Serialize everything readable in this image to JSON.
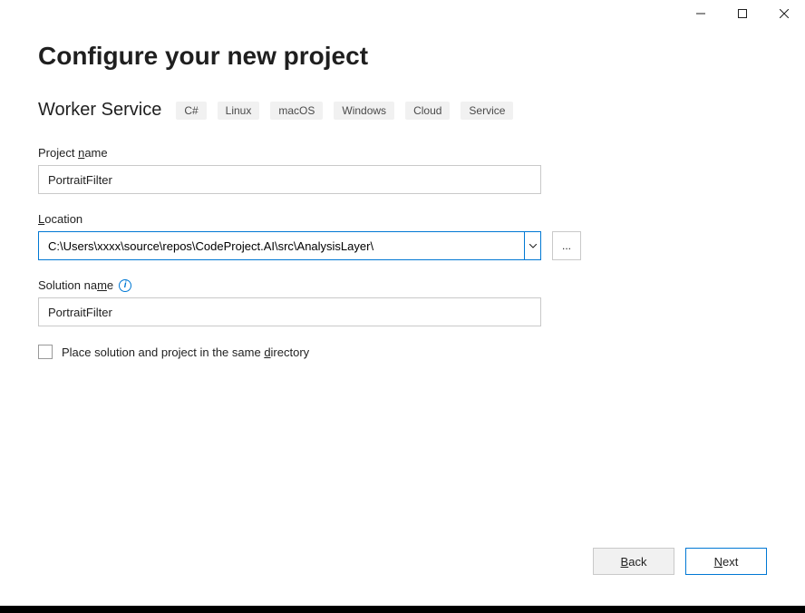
{
  "window": {
    "minimize": "Minimize",
    "maximize": "Maximize",
    "close": "Close"
  },
  "heading": "Configure your new project",
  "template": {
    "name": "Worker Service",
    "tags": [
      "C#",
      "Linux",
      "macOS",
      "Windows",
      "Cloud",
      "Service"
    ]
  },
  "fields": {
    "projectName": {
      "label": "Project name",
      "underlineIndex": 8,
      "value": "PortraitFilter"
    },
    "location": {
      "label": "Location",
      "underlineIndex": 0,
      "value": "C:\\Users\\xxxx\\source\\repos\\CodeProject.AI\\src\\AnalysisLayer\\",
      "browseLabel": "..."
    },
    "solutionName": {
      "label": "Solution name",
      "underlineIndex": 10,
      "value": "PortraitFilter",
      "infoGlyph": "i"
    },
    "sameDirectory": {
      "label": "Place solution and project in the same directory",
      "underlineIndex": 39,
      "checked": false
    }
  },
  "footer": {
    "back": "Back",
    "backUnderlineIndex": 0,
    "next": "Next",
    "nextUnderlineIndex": 0
  }
}
